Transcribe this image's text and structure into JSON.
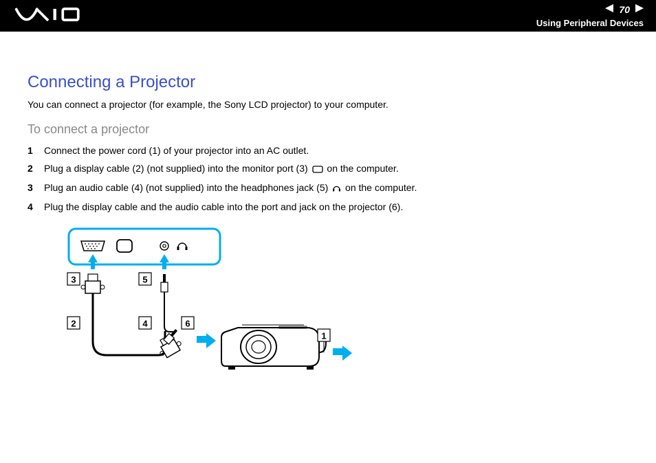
{
  "header": {
    "page_number": "70",
    "section": "Using Peripheral Devices"
  },
  "body": {
    "title": "Connecting a Projector",
    "intro": "You can connect a projector (for example, the Sony LCD projector) to your computer.",
    "subtitle": "To connect a projector",
    "steps": [
      {
        "n": "1",
        "text_before": "Connect the power cord (1) of your projector into an AC outlet.",
        "icon": "",
        "text_after": ""
      },
      {
        "n": "2",
        "text_before": "Plug a display cable (2) (not supplied) into the monitor port (3) ",
        "icon": "monitor",
        "text_after": " on the computer."
      },
      {
        "n": "3",
        "text_before": "Plug an audio cable (4) (not supplied) into the headphones jack (5) ",
        "icon": "headphones",
        "text_after": " on the computer."
      },
      {
        "n": "4",
        "text_before": "Plug the display cable and the audio cable into the port and jack on the projector (6).",
        "icon": "",
        "text_after": ""
      }
    ]
  },
  "diagram": {
    "callouts": {
      "1": "1",
      "2": "2",
      "3": "3",
      "4": "4",
      "5": "5",
      "6": "6"
    }
  }
}
